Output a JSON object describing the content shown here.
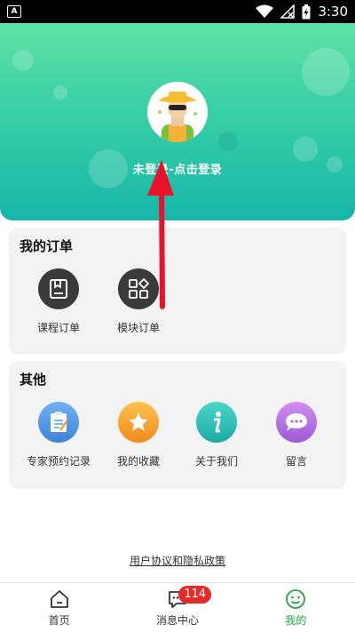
{
  "status_bar": {
    "notification_icon": "A",
    "time": "3:30",
    "icons": [
      "wifi-icon",
      "signal-off-icon",
      "battery-charging-icon"
    ]
  },
  "header": {
    "login_prompt": "未登录-点击登录",
    "avatar_icon": "farmer-avatar-icon"
  },
  "orders": {
    "title": "我的订单",
    "items": [
      {
        "label": "课程订单",
        "icon": "book-icon"
      },
      {
        "label": "模块订单",
        "icon": "modules-icon"
      }
    ]
  },
  "other": {
    "title": "其他",
    "items": [
      {
        "label": "专家预约记录",
        "icon": "clipboard-icon",
        "color": "#4a90e2"
      },
      {
        "label": "我的收藏",
        "icon": "star-icon",
        "color": "#f5a623"
      },
      {
        "label": "关于我们",
        "icon": "info-icon",
        "color": "#2ec4b6"
      },
      {
        "label": "留言",
        "icon": "chat-icon",
        "color": "#b06ad9"
      }
    ]
  },
  "policy_link": "用户协议和隐私政策",
  "tabbar": {
    "items": [
      {
        "label": "首页",
        "icon": "home-icon",
        "active": false
      },
      {
        "label": "消息中心",
        "icon": "message-icon",
        "active": false,
        "badge": "114"
      },
      {
        "label": "我的",
        "icon": "smile-icon",
        "active": true
      }
    ]
  },
  "colors": {
    "header_top": "#5fe1a5",
    "header_bottom": "#17b6a9",
    "active_tab": "#1faa3a",
    "badge": "#e62a2a",
    "arrow": "#e8132a"
  }
}
